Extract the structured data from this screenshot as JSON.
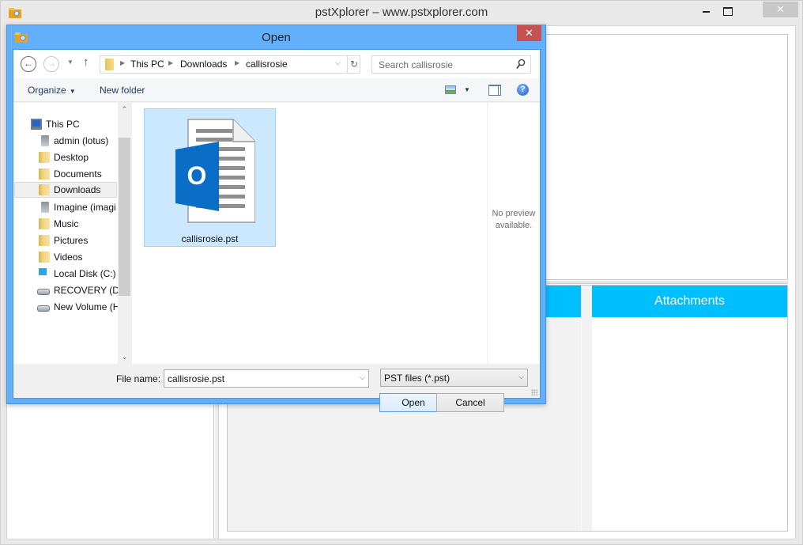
{
  "app": {
    "title": "pstXplorer – www.pstxplorer.com",
    "close_glyph": "✕",
    "attachments_header": "Attachments"
  },
  "dialog": {
    "title": "Open",
    "close_glyph": "✕",
    "nav": {
      "back_glyph": "←",
      "forward_glyph": "→",
      "recent_glyph": "▼",
      "up_glyph": "↑",
      "breadcrumb": [
        "This PC",
        "Downloads",
        "callisrosie"
      ],
      "breadcrumb_sep": "▶",
      "dropdown_glyph": "⌵",
      "refresh_glyph": "↻"
    },
    "search": {
      "placeholder": "Search callisrosie"
    },
    "toolbar": {
      "organize_label": "Organize",
      "caret": "▼",
      "new_folder_label": "New folder",
      "views_caret": "▼",
      "help_glyph": "?"
    },
    "tree": {
      "scroll_up": "⌃",
      "scroll_down": "⌄",
      "selected": "Downloads",
      "items": [
        {
          "label": "This PC",
          "icon": "computer-icon"
        },
        {
          "label": "admin (lotus)",
          "icon": "network-drive-icon"
        },
        {
          "label": "Desktop",
          "icon": "desktop-folder-icon"
        },
        {
          "label": "Documents",
          "icon": "documents-folder-icon"
        },
        {
          "label": "Downloads",
          "icon": "downloads-folder-icon"
        },
        {
          "label": "Imagine (imagi",
          "icon": "network-drive-icon"
        },
        {
          "label": "Music",
          "icon": "music-folder-icon"
        },
        {
          "label": "Pictures",
          "icon": "pictures-folder-icon"
        },
        {
          "label": "Videos",
          "icon": "videos-folder-icon"
        },
        {
          "label": "Local Disk (C:)",
          "icon": "windows-disk-icon"
        },
        {
          "label": "RECOVERY (D:)",
          "icon": "disk-drive-icon"
        },
        {
          "label": "New Volume (H",
          "icon": "disk-drive-icon"
        }
      ]
    },
    "files": [
      {
        "name": "callisrosie.pst",
        "icon": "outlook-pst-file-icon",
        "selected": true
      }
    ],
    "outlook_letter": "O",
    "preview": {
      "text_line1": "No preview",
      "text_line2": "available."
    },
    "file_name_label": "File name:",
    "file_name_value": "callisrosie.pst",
    "file_type_value": "PST files (*.pst)",
    "combo_arrow": "⌵",
    "open_label": "Open",
    "cancel_label": "Cancel"
  },
  "colors": {
    "dialog_frame": "#62b0fb",
    "close_red": "#c75050",
    "header_cyan": "#00bfff",
    "selection_fill": "#cce8ff",
    "outlook_blue": "#0a6ec7"
  }
}
